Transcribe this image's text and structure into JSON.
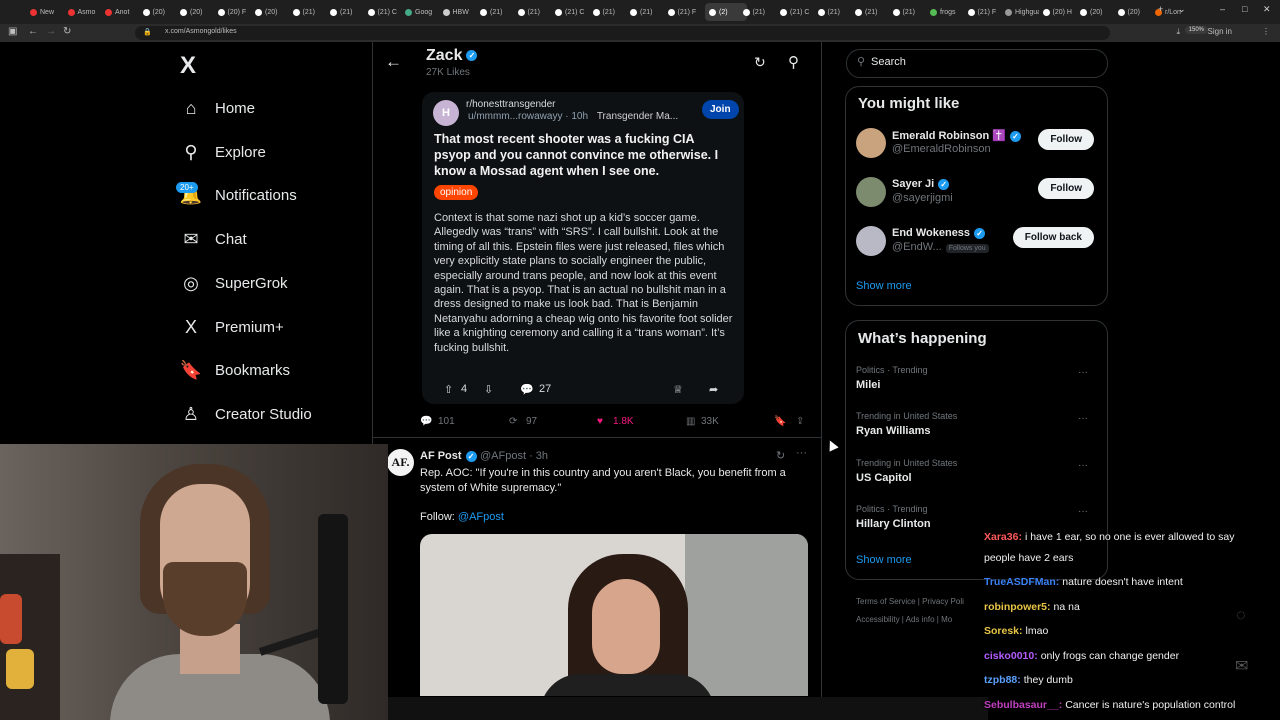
{
  "browser": {
    "tabs": [
      "New",
      "Asmo",
      "Anot",
      "(20)",
      "(20)",
      "(20) F",
      "(20)",
      "(21)",
      "(21)",
      "(21) C",
      "Goog",
      "HBW",
      "(21)",
      "(21)",
      "(21) C",
      "(21)",
      "(21)",
      "(21) F",
      "(2)",
      "(21)",
      "(21) C",
      "(21)",
      "(21)",
      "(21)",
      "frogs",
      "(21) F",
      "Highguar",
      "(20) H",
      "(20)",
      "(20)",
      "r/Lon"
    ],
    "active_tab_index": 18,
    "url": "x.com/Asmongold/likes",
    "zoom": "150%",
    "sign_in": "Sign in"
  },
  "nav": {
    "logo": "X",
    "items": [
      {
        "label": "Home",
        "icon": "home-icon",
        "glyph": "⌂"
      },
      {
        "label": "Explore",
        "icon": "search-icon",
        "glyph": "⚲"
      },
      {
        "label": "Notifications",
        "icon": "bell-icon",
        "glyph": "🔔"
      },
      {
        "label": "Chat",
        "icon": "mail-icon",
        "glyph": "✉"
      },
      {
        "label": "SuperGrok",
        "icon": "grok-icon",
        "glyph": "◎"
      },
      {
        "label": "Premium+",
        "icon": "x-logo-icon",
        "glyph": "X"
      },
      {
        "label": "Bookmarks",
        "icon": "bookmark-icon",
        "glyph": "🔖"
      },
      {
        "label": "Creator Studio",
        "icon": "creator-icon",
        "glyph": "♙"
      }
    ],
    "notif_badge": "20+"
  },
  "profile": {
    "name": "Zack",
    "likes": "27K Likes"
  },
  "reddit_post": {
    "avatar_letter": "H",
    "subreddit": "r/honesttransgender",
    "user": "u/mmmm...rowawayy",
    "age": "10h",
    "tag": "Transgender Ma...",
    "join": "Join",
    "title": "That most recent shooter was a fucking CIA psyop and you cannot convince me otherwise. I know a Mossad agent when I see one.",
    "flair": "opinion",
    "body": "Context is that some nazi shot up a kid’s soccer game. Allegedly was “trans” with “SRS”. I call bullshit. Look at the timing of all this. Epstein files were just released, files which very explicitly state plans to socially engineer the public, especially around trans people, and now look at this event again. That is a psyop. That is an actual no bullshit man in a dress designed to make us look bad. That is Benjamin Netanyahu adorning a cheap wig onto his favorite foot solider like a knighting ceremony and calling it a “trans woman”. It’s fucking bullshit.",
    "upvotes": "4",
    "comments": "27"
  },
  "tweet_actions": {
    "replies": "101",
    "reposts": "97",
    "likes": "1.8K",
    "views": "33K"
  },
  "tweet2": {
    "avatar_text": "AF.",
    "name": "AF Post",
    "handle": "@AFpost · 3h",
    "text": "Rep. AOC: \"If you're in this country and you aren't Black, you benefit from a system of White supremacy.\"",
    "follow_prefix": "Follow: ",
    "follow_link": "@AFpost"
  },
  "right": {
    "search_placeholder": "Search",
    "wtf_title": "You might like",
    "wtf": [
      {
        "name": "Emerald Robinson ✝️",
        "handle": "@EmeraldRobinson",
        "button": "Follow",
        "follows_you": "",
        "avatar_color": "#c9a27e"
      },
      {
        "name": "Sayer Ji",
        "handle": "@sayerjigmi",
        "button": "Follow",
        "follows_you": "",
        "avatar_color": "#7c8a6e"
      },
      {
        "name": "End Wokeness",
        "handle": "@EndW...",
        "button": "Follow back",
        "follows_you": "Follows you",
        "avatar_color": "#b9b9c6"
      }
    ],
    "show_more": "Show more",
    "trends_title": "What’s happening",
    "trends": [
      {
        "context": "Politics · Trending",
        "title": "Milei"
      },
      {
        "context": "Trending in United States",
        "title": "Ryan Williams"
      },
      {
        "context": "Trending in United States",
        "title": "US Capitol"
      },
      {
        "context": "Politics · Trending",
        "title": "Hillary Clinton"
      }
    ],
    "trends_show_more": "Show more",
    "footer1": "Terms of Service  |  Privacy Poli",
    "footer2": "Accessibility  |  Ads info  |  Mo"
  },
  "chat": [
    {
      "user": "Xara36:",
      "msg": "i have 1 ear, so no one is ever allowed to say people have 2 ears",
      "color": "#ff5a5a"
    },
    {
      "user": "TrueASDFMan:",
      "msg": "nature doesn't have intent",
      "color": "#3b82f6"
    },
    {
      "user": "robinpower5:",
      "msg": "na na",
      "color": "#e8c547"
    },
    {
      "user": "Soresk:",
      "msg": "lmao",
      "color": "#e8c547"
    },
    {
      "user": "cisko0010:",
      "msg": "only frogs can change gender",
      "color": "#b45cff"
    },
    {
      "user": "tzpb88:",
      "msg": "they dumb",
      "color": "#5aa0ff"
    },
    {
      "user": "Sebulbasaur__:",
      "msg": "Cancer is nature's population control",
      "color": "#c040c0"
    }
  ]
}
